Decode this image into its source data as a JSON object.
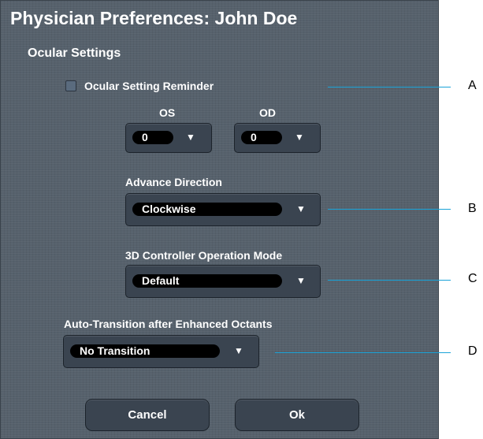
{
  "dialog": {
    "title": "Physician Preferences: John Doe",
    "section_title": "Ocular Settings"
  },
  "ocular_reminder": {
    "label": "Ocular Setting Reminder",
    "checked": false
  },
  "os": {
    "label": "OS",
    "value": "0",
    "arrow": "▼"
  },
  "od": {
    "label": "OD",
    "value": "0",
    "arrow": "▼"
  },
  "advance_direction": {
    "label": "Advance Direction",
    "value": "Clockwise",
    "arrow": "▼"
  },
  "controller_mode": {
    "label": "3D Controller Operation Mode",
    "value": "Default",
    "arrow": "▼"
  },
  "auto_transition": {
    "label": "Auto-Transition after Enhanced Octants",
    "value": "No Transition",
    "arrow": "▼"
  },
  "buttons": {
    "cancel": "Cancel",
    "ok": "Ok"
  },
  "callouts": {
    "a": "A",
    "b": "B",
    "c": "C",
    "d": "D"
  },
  "colors": {
    "callout_line": "#1aa3d8",
    "panel": "#56616c",
    "control": "#3a4450"
  }
}
